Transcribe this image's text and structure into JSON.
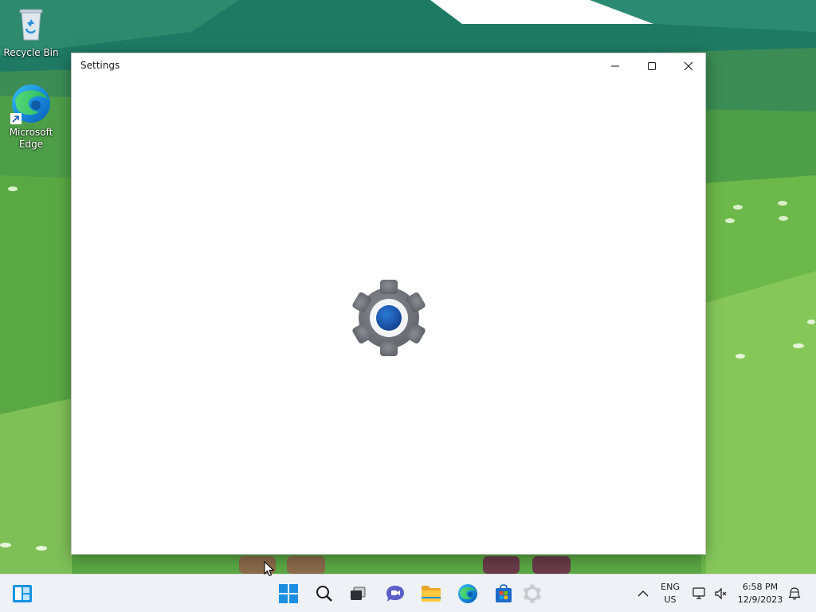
{
  "desktop": {
    "icons": [
      {
        "label": "Recycle Bin",
        "icon": "recycle-bin-icon"
      },
      {
        "label": "Microsoft Edge",
        "icon": "edge-icon"
      }
    ]
  },
  "window": {
    "title": "Settings",
    "splash_icon": "settings-gear-icon",
    "controls": {
      "minimize": "minimize-icon",
      "maximize": "maximize-icon",
      "close": "close-icon"
    }
  },
  "taskbar": {
    "widgets_icon": "widgets-icon",
    "apps": [
      {
        "name": "Start",
        "icon": "windows-logo-icon"
      },
      {
        "name": "Search",
        "icon": "search-icon"
      },
      {
        "name": "Task View",
        "icon": "task-view-icon"
      },
      {
        "name": "Chat",
        "icon": "chat-icon"
      },
      {
        "name": "File Explorer",
        "icon": "folder-icon"
      },
      {
        "name": "Microsoft Edge",
        "icon": "edge-icon"
      },
      {
        "name": "Microsoft Store",
        "icon": "store-icon"
      },
      {
        "name": "Settings",
        "icon": "settings-gear-icon"
      }
    ],
    "tray": {
      "language_line1": "ENG",
      "language_line2": "US",
      "time": "6:58 PM",
      "date": "12/9/2023"
    }
  },
  "colors": {
    "accent": "#0067c0",
    "gear_gray": "#6b6f75",
    "gear_blue": "#1f5fb8"
  }
}
